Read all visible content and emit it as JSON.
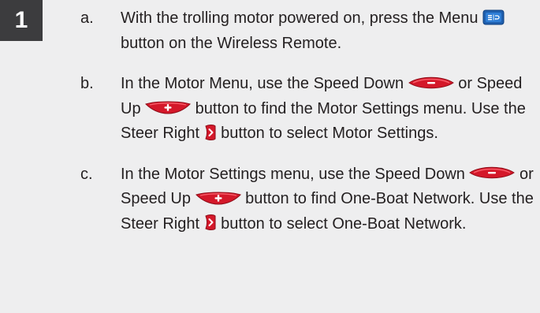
{
  "step_number": "1",
  "items": [
    {
      "letter": "a.",
      "parts": [
        {
          "t": "text",
          "v": "With the trolling motor powered on, press the Menu "
        },
        {
          "t": "icon",
          "icon": "menu-button-icon"
        },
        {
          "t": "text",
          "v": " button on the Wireless Remote."
        }
      ]
    },
    {
      "letter": "b.",
      "parts": [
        {
          "t": "text",
          "v": "In the Motor Menu, use the Speed Down "
        },
        {
          "t": "icon",
          "icon": "speed-down-button-icon"
        },
        {
          "t": "text",
          "v": " or Speed Up "
        },
        {
          "t": "icon",
          "icon": "speed-up-button-icon"
        },
        {
          "t": "text",
          "v": " button to find the Motor Settings menu. Use the Steer Right "
        },
        {
          "t": "icon",
          "icon": "steer-right-button-icon"
        },
        {
          "t": "text",
          "v": " button to select Motor Settings."
        }
      ]
    },
    {
      "letter": "c.",
      "parts": [
        {
          "t": "text",
          "v": "In the Motor Settings menu, use the Speed Down "
        },
        {
          "t": "icon",
          "icon": "speed-down-button-icon"
        },
        {
          "t": "text",
          "v": " or Speed Up "
        },
        {
          "t": "icon",
          "icon": "speed-up-button-icon"
        },
        {
          "t": "text",
          "v": " button to find One-Boat Network. Use the Steer Right "
        },
        {
          "t": "icon",
          "icon": "steer-right-button-icon"
        },
        {
          "t": "text",
          "v": " button to select One-Boat Network."
        }
      ]
    }
  ],
  "colors": {
    "background": "#eeeeef",
    "badge": "#3c3c3e",
    "text": "#231f20",
    "button_red": "#d4182a",
    "menu_blue": "#1f5fae"
  }
}
